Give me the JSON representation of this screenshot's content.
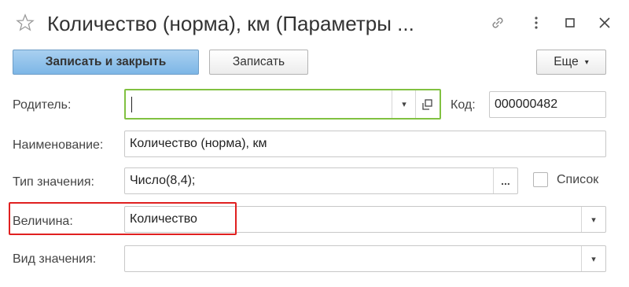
{
  "window": {
    "title": "Количество (норма), км (Параметры ...",
    "icons": [
      "star-icon",
      "link-icon",
      "more-vertical-icon",
      "maximize-icon",
      "close-icon"
    ]
  },
  "toolbar": {
    "save_close_label": "Записать и закрыть",
    "save_label": "Записать",
    "more_label": "Еще"
  },
  "form": {
    "parent": {
      "label": "Родитель:",
      "value": ""
    },
    "code": {
      "label": "Код:",
      "value": "000000482"
    },
    "name": {
      "label": "Наименование:",
      "value": "Количество (норма), км"
    },
    "value_type": {
      "label": "Тип значения:",
      "value": "Число(8,4);",
      "select_button": "..."
    },
    "list": {
      "label": "Список",
      "checked": false
    },
    "quantity": {
      "label": "Величина:",
      "value": "Количество"
    },
    "value_kind": {
      "label": "Вид значения:",
      "value": ""
    }
  },
  "colors": {
    "primary_button": "#7db6e6",
    "focus_border": "#81c141",
    "highlight_border": "#e02020"
  }
}
